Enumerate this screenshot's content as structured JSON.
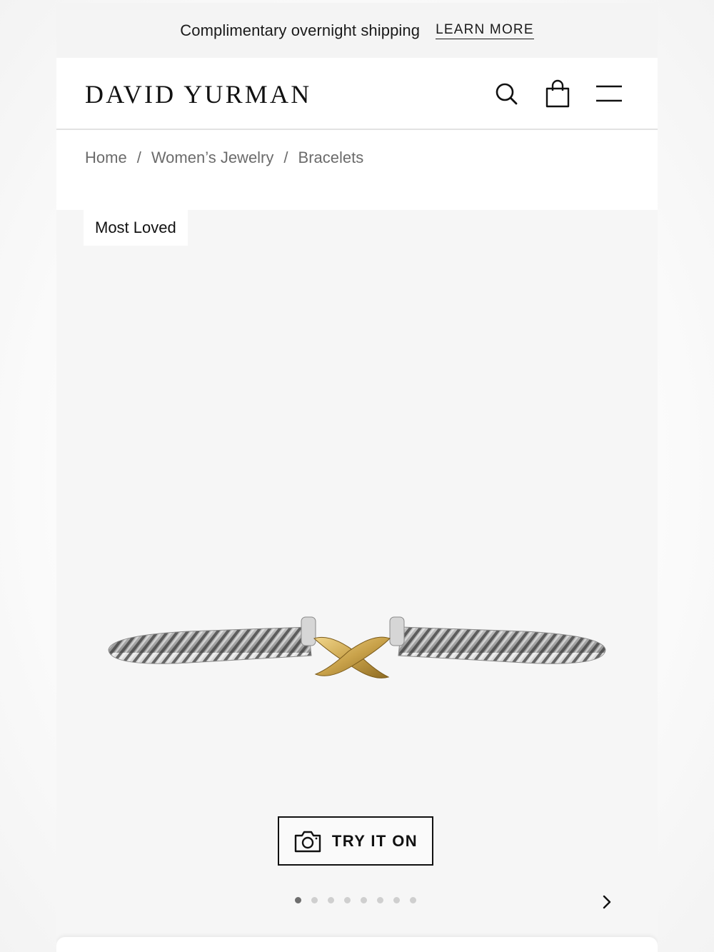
{
  "promo": {
    "text": "Complimentary overnight shipping",
    "link_label": "LEARN MORE"
  },
  "header": {
    "logo": "DAVID YURMAN",
    "icons": [
      "search-icon",
      "shopping-bag-icon",
      "menu-icon"
    ]
  },
  "breadcrumb": {
    "items": [
      "Home",
      "Women’s Jewelry",
      "Bracelets"
    ],
    "separator": "/"
  },
  "gallery": {
    "badge": "Most Loved",
    "try_on_label": "TRY IT ON",
    "current_slide": 1,
    "total_slides": 8
  },
  "colors": {
    "text": "#111111",
    "muted": "#6b6b6b",
    "background": "#f6f6f6",
    "gold": "#c9a24a",
    "silver": "#b8b8b8"
  }
}
